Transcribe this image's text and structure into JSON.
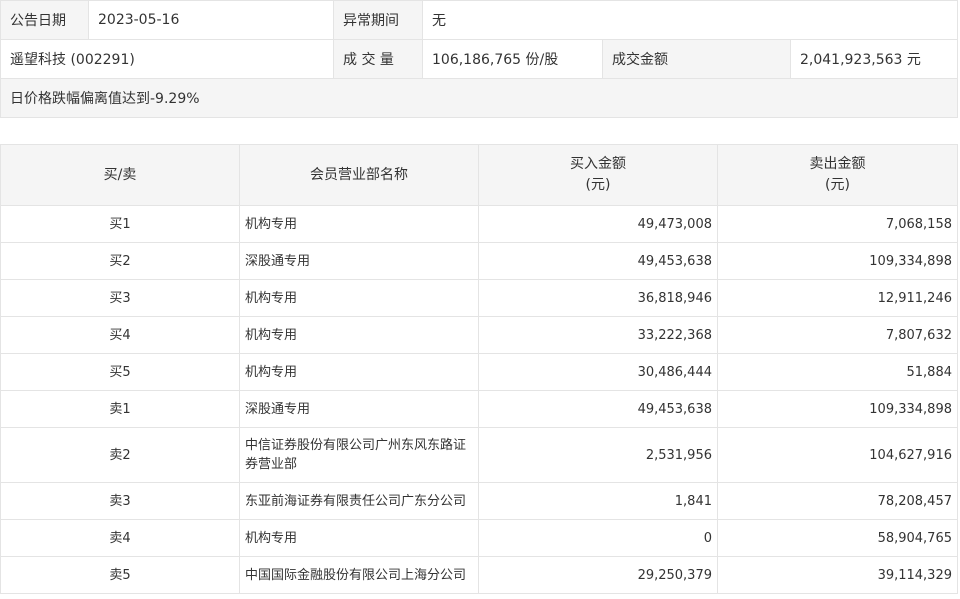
{
  "info": {
    "announce_date_label": "公告日期",
    "announce_date": "2023-05-16",
    "abnormal_period_label": "异常期间",
    "abnormal_period": "无",
    "stock": "遥望科技 (002291)",
    "volume_label": "成 交 量",
    "volume": "106,186,765 份/股",
    "amount_label": "成交金额",
    "amount": "2,041,923,563 元",
    "reason": "日价格跌幅偏离值达到-9.29%"
  },
  "table": {
    "headers": {
      "side": "买/卖",
      "broker": "会员营业部名称",
      "buy_title": "买入金额",
      "buy_unit": "(元)",
      "sell_title": "卖出金额",
      "sell_unit": "(元)"
    },
    "rows": [
      {
        "side": "买1",
        "broker": "机构专用",
        "buy": "49,473,008",
        "sell": "7,068,158"
      },
      {
        "side": "买2",
        "broker": "深股通专用",
        "buy": "49,453,638",
        "sell": "109,334,898"
      },
      {
        "side": "买3",
        "broker": "机构专用",
        "buy": "36,818,946",
        "sell": "12,911,246"
      },
      {
        "side": "买4",
        "broker": "机构专用",
        "buy": "33,222,368",
        "sell": "7,807,632"
      },
      {
        "side": "买5",
        "broker": "机构专用",
        "buy": "30,486,444",
        "sell": "51,884"
      },
      {
        "side": "卖1",
        "broker": "深股通专用",
        "buy": "49,453,638",
        "sell": "109,334,898"
      },
      {
        "side": "卖2",
        "broker": "中信证券股份有限公司广州东风东路证券营业部",
        "buy": "2,531,956",
        "sell": "104,627,916"
      },
      {
        "side": "卖3",
        "broker": "东亚前海证券有限责任公司广东分公司",
        "buy": "1,841",
        "sell": "78,208,457"
      },
      {
        "side": "卖4",
        "broker": "机构专用",
        "buy": "0",
        "sell": "58,904,765"
      },
      {
        "side": "卖5",
        "broker": "中国国际金融股份有限公司上海分公司",
        "buy": "29,250,379",
        "sell": "39,114,329"
      }
    ]
  }
}
